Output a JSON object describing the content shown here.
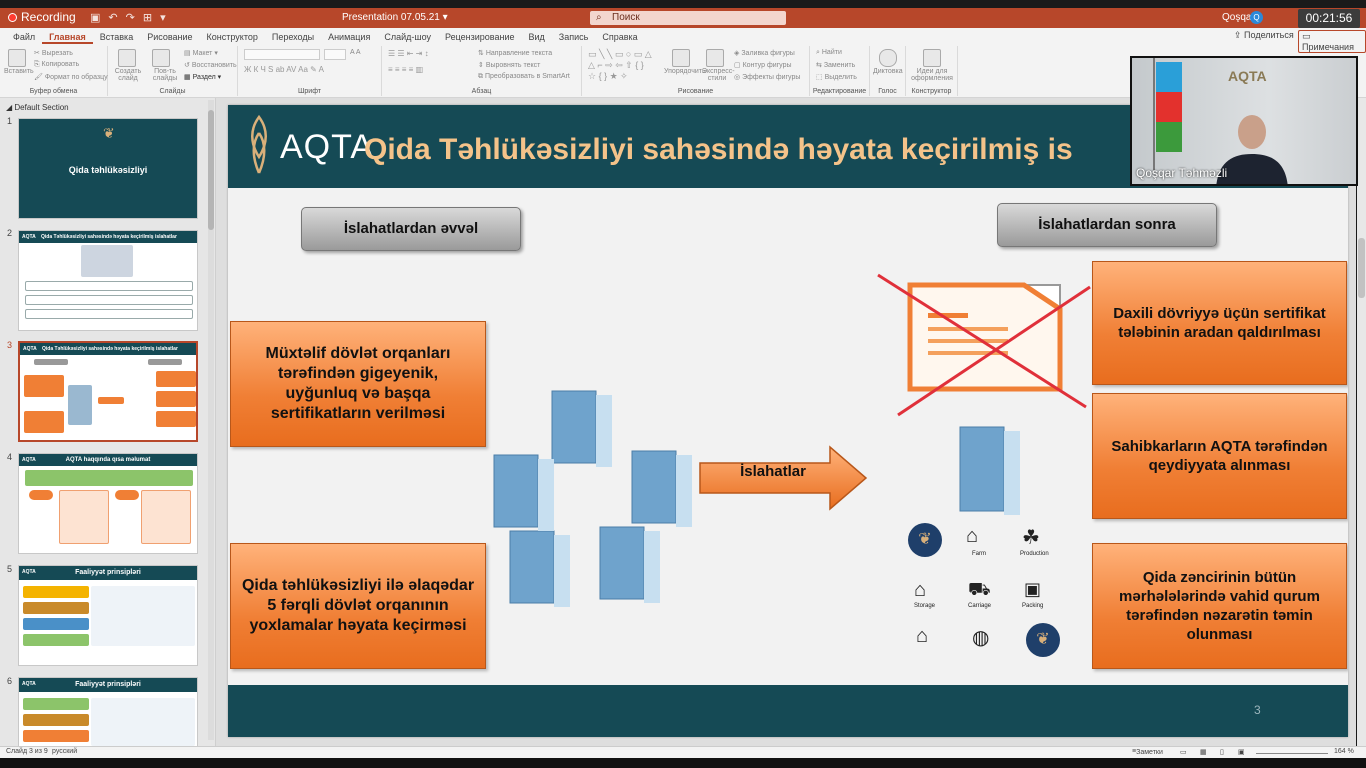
{
  "titlebar": {
    "recording": "Recording",
    "doc_title": "Presentation 07.05.21 ▾",
    "search_placeholder": "Поиск",
    "user": "Qoşqar",
    "user_initial": "Q",
    "timer": "00:21:56"
  },
  "ribbon": {
    "tabs": [
      "Файл",
      "Главная",
      "Вставка",
      "Рисование",
      "Конструктор",
      "Переходы",
      "Анимация",
      "Слайд-шоу",
      "Рецензирование",
      "Вид",
      "Запись",
      "Справка"
    ],
    "active_tab": "Главная",
    "share": "Поделиться",
    "notes": "Примечания",
    "groups": {
      "clipboard": "Буфер обмена",
      "slides": "Слайды",
      "font": "Шрифт",
      "paragraph": "Абзац",
      "drawing": "Рисование",
      "editing": "Редактирование",
      "voice": "Голос",
      "designer": "Конструктор"
    },
    "items": {
      "paste": "Вставить",
      "cut": "Вырезать",
      "copy": "Копировать",
      "format_painter": "Формат по образцу",
      "new_slide": "Создать слайд",
      "reuse_slides": "Пов-ть слайды",
      "layout": "Макет",
      "reset": "Восстановить",
      "section": "Раздел",
      "text_direction": "Направление текста",
      "align_text": "Выровнять текст",
      "smartart": "Преобразовать в SmartArt",
      "arrange": "Упорядочить",
      "quick_styles": "Экспресс-стили",
      "shape_fill": "Заливка фигуры",
      "shape_outline": "Контур фигуры",
      "shape_effects": "Эффекты фигуры",
      "find": "Найти",
      "replace": "Заменить",
      "select": "Выделить",
      "dictate": "Диктовка",
      "design_ideas": "Идеи для оформления"
    }
  },
  "thumbnails": {
    "section": "Default Section",
    "slides": [
      {
        "num": "1",
        "title": "Qida təhlükəsizliyi"
      },
      {
        "num": "2",
        "title": "Qida Təhlükəsizliyi sahəsində həyata keçirilmiş islahatlar"
      },
      {
        "num": "3",
        "title": "Qida Təhlükəsizliyi sahəsində həyata keçirilmiş islahatlar"
      },
      {
        "num": "4",
        "title": "AQTA haqqında qısa məlumat"
      },
      {
        "num": "5",
        "title": "Faaliyyət prinsipləri"
      },
      {
        "num": "6",
        "title": "Faaliyyət prinsipləri"
      }
    ]
  },
  "slide": {
    "logo": "AQTA",
    "title": "Qida Təhlükəsizliyi sahəsində həyata keçirilmiş is",
    "before_label": "İslahatlardan əvvəl",
    "after_label": "İslahatlardan sonra",
    "left_box_1": "Müxtəlif dövlət orqanları tərəfindən gigeyenik, uyğunluq və başqa sertifikatların verilməsi",
    "left_box_2": "Qida təhlükəsizliyi ilə əlaqədar 5 fərqli dövlət orqanının yoxlamalar həyata keçirməsi",
    "arrow_label": "İslahatlar",
    "right_box_1": "Daxili dövriyyə üçün sertifikat tələbinin aradan qaldırılması",
    "right_box_2": "Sahibkarların AQTA tərəfindən qeydiyyata alınması",
    "right_box_3": "Qida zəncirinin bütün mərhələlərində vahid qurum tərəfindən nəzarətin təmin olunması",
    "chain_labels": {
      "farm": "Farm",
      "production": "Production",
      "storage": "Storage",
      "carriage": "Carriage",
      "packing": "Packing"
    },
    "page_number": "3"
  },
  "video": {
    "name": "Qoşqar Təhməzli",
    "bg_logo": "AQTA"
  },
  "statusbar": {
    "slide_info": "Слайд 3 из 9",
    "language": "русский",
    "notes": "Заметки",
    "zoom": "164 %"
  },
  "colors": {
    "accent": "#b7472a",
    "slide_header": "#154a55",
    "title_orange": "#f4c38a",
    "box_orange": "#f07f35"
  }
}
